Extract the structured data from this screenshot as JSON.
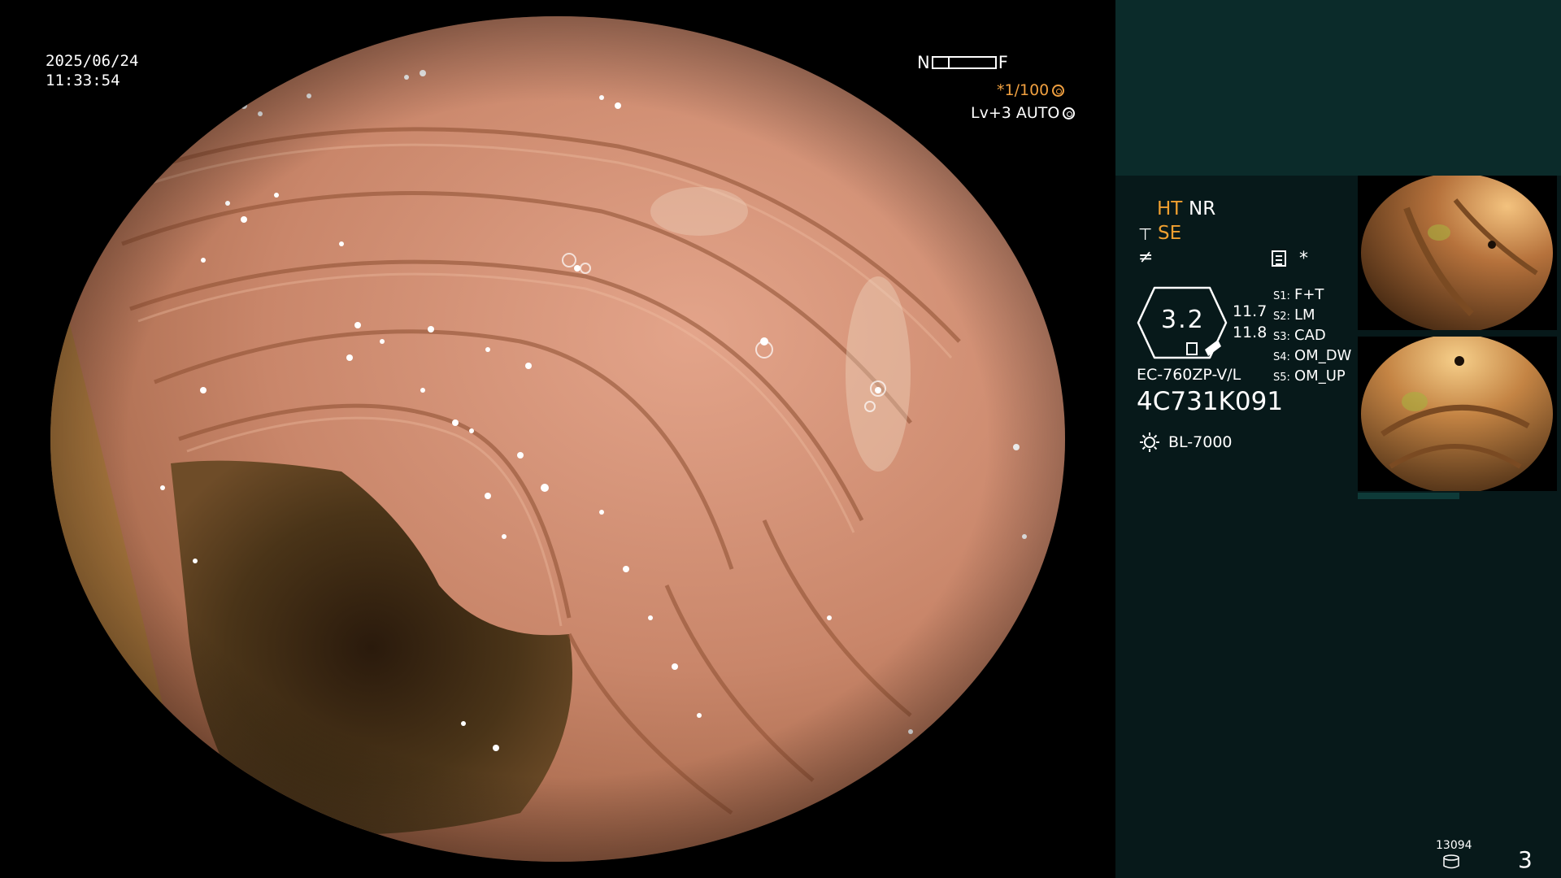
{
  "overlay": {
    "date": "2025/06/24",
    "time": "11:33:54",
    "near_label": "N",
    "far_label": "F",
    "shutter": "*1/100",
    "level": "Lv+3 AUTO",
    "shutter_icon": "aperture-icon",
    "auto_icon": "auto-iris-icon"
  },
  "panel": {
    "ht": "HT",
    "nr": "NR",
    "se": "SE",
    "star": "*",
    "iris_value": "3.2",
    "value_top": "11.7",
    "value_bottom": "11.8",
    "slots": [
      {
        "key": "S1:",
        "value": "F+T"
      },
      {
        "key": "S2:",
        "value": "LM"
      },
      {
        "key": "S3:",
        "value": "CAD"
      },
      {
        "key": "S4:",
        "value": "OM_DW"
      },
      {
        "key": "S5:",
        "value": "OM_UP"
      }
    ],
    "scope_model": "EC-760ZP-V/L",
    "serial": "4C731K091",
    "light_source": "BL-7000",
    "image_count": "13094",
    "page_number": "3"
  },
  "colors": {
    "panel_top": "#0b2b2a",
    "panel": "#07191a",
    "accent_orange": "#f0a030"
  },
  "icons": [
    "scope-icon",
    "freeze-icon",
    "document-icon",
    "light-source-icon",
    "database-icon"
  ]
}
